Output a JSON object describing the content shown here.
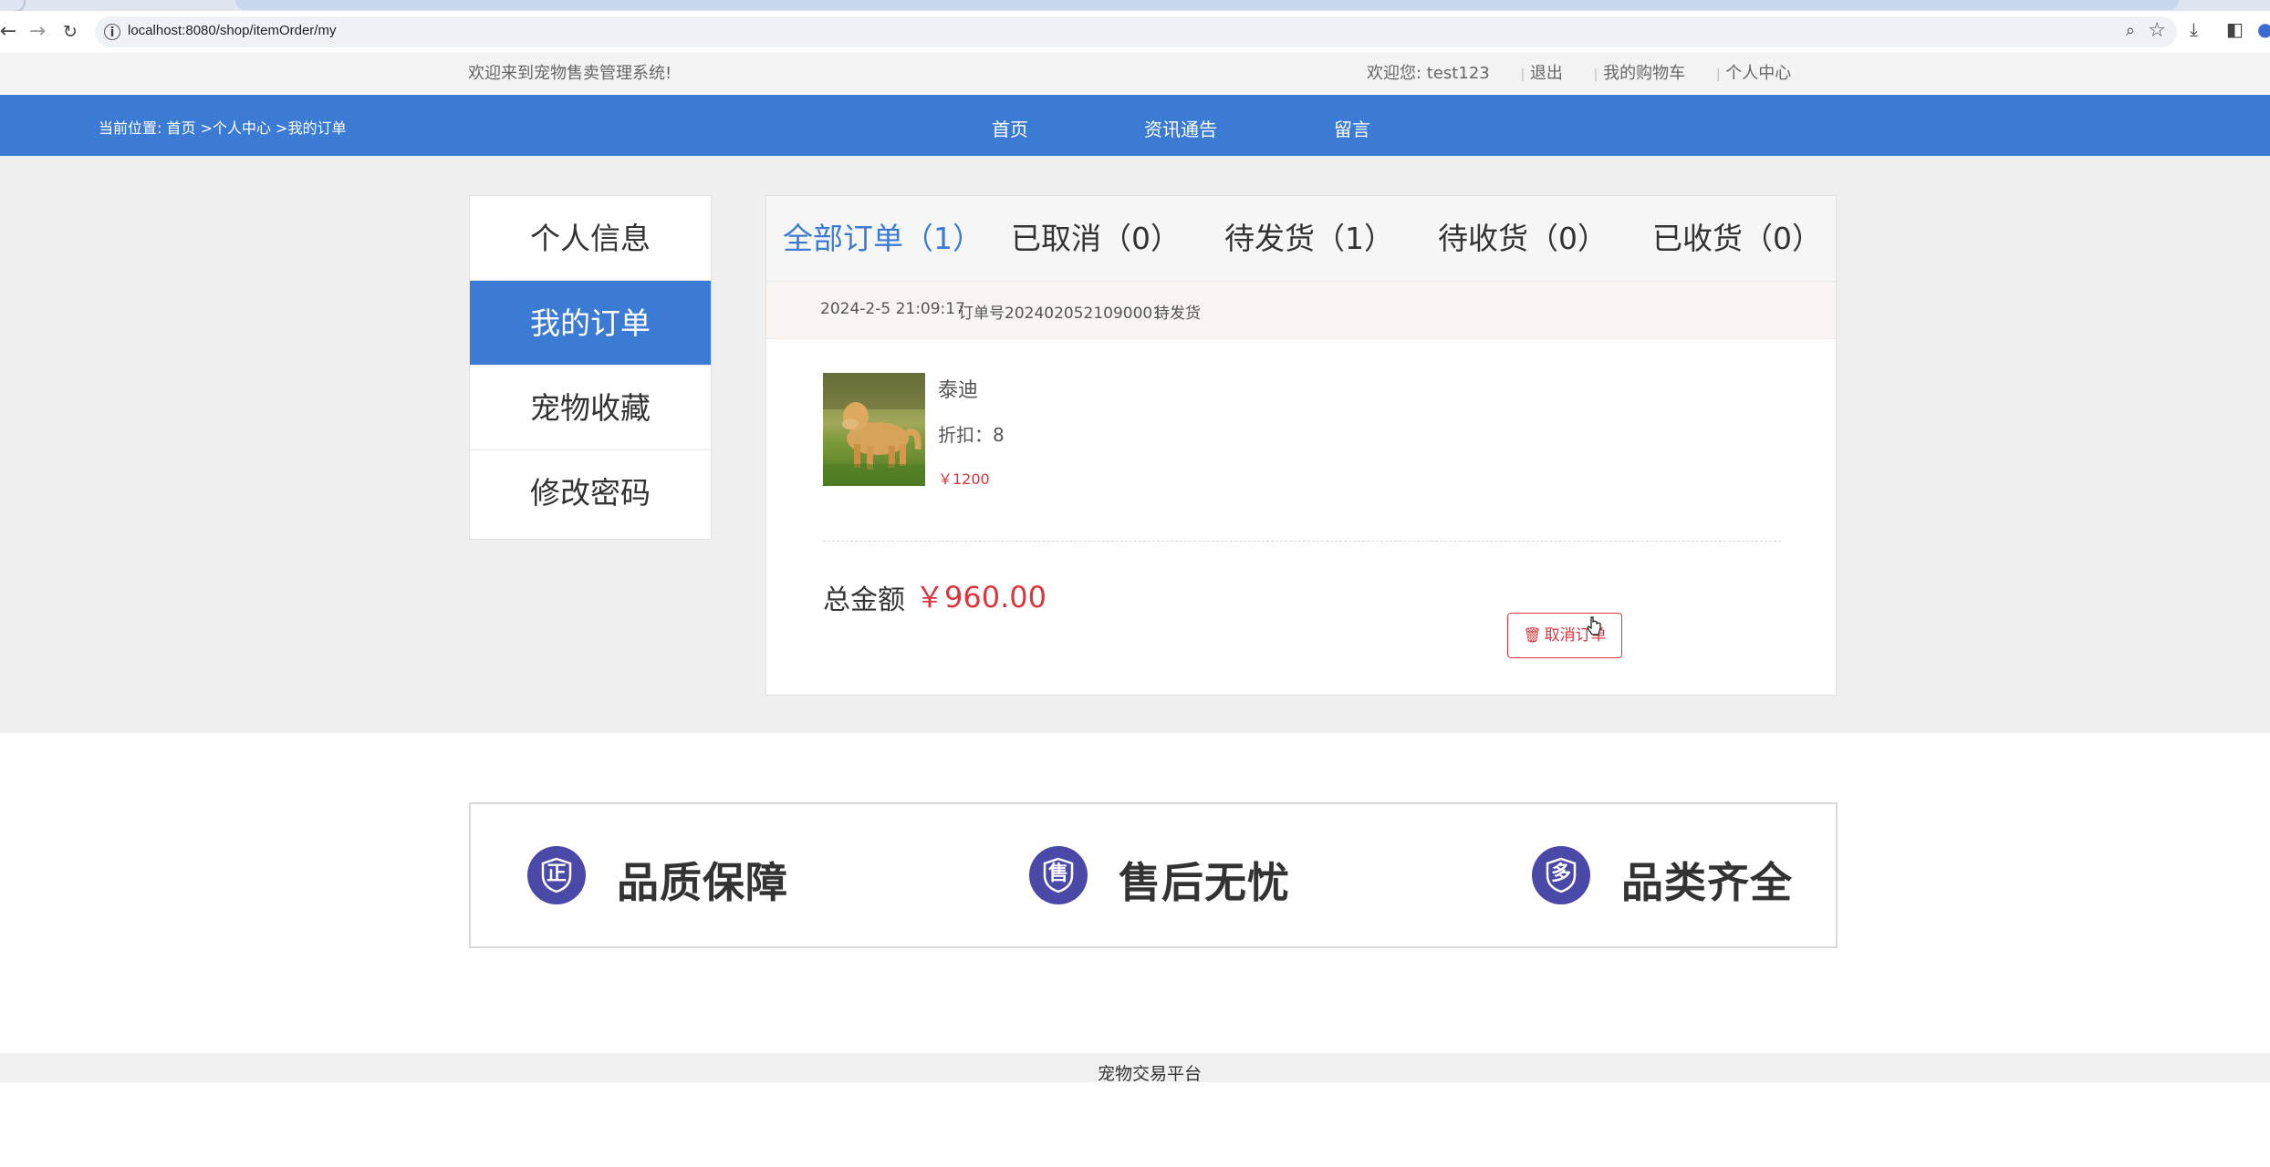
{
  "browser": {
    "url": "localhost:8080/shop/itemOrder/my"
  },
  "topbar": {
    "welcome": "欢迎来到宠物售卖管理系统!",
    "greeting_prefix": "欢迎您: ",
    "username": "test123",
    "logout": "退出",
    "cart": "我的购物车",
    "center": "个人中心"
  },
  "nav": {
    "breadcrumb": "当前位置: 首页 >个人中心 >我的订单",
    "links": [
      "首页",
      "资讯通告",
      "留言"
    ]
  },
  "sidebar": {
    "items": [
      "个人信息",
      "我的订单",
      "宠物收藏",
      "修改密码"
    ],
    "active_index": 1
  },
  "orders": {
    "tabs": [
      "全部订单（1）",
      "已取消（0）",
      "待发货（1）",
      "待收货（0）",
      "已收货（0）"
    ],
    "active_tab": 0,
    "order": {
      "date": "2024-2-5 21:09:17",
      "number": "订单号2024020521090001",
      "status": "待发货",
      "item_name": "泰迪",
      "discount": "折扣：8",
      "price": "￥1200",
      "total_label": "总金额",
      "total_value": "￥960.00",
      "cancel_label": "取消订单"
    }
  },
  "guarantees": [
    "品质保障",
    "售后无忧",
    "品类齐全"
  ],
  "guarantee_icons": [
    "正",
    "售",
    "多"
  ],
  "footer": "宠物交易平台",
  "colors": {
    "brand_blue": "#3b7bd4",
    "price_red": "#d9363e",
    "icon_purple": "#4a49a8"
  }
}
